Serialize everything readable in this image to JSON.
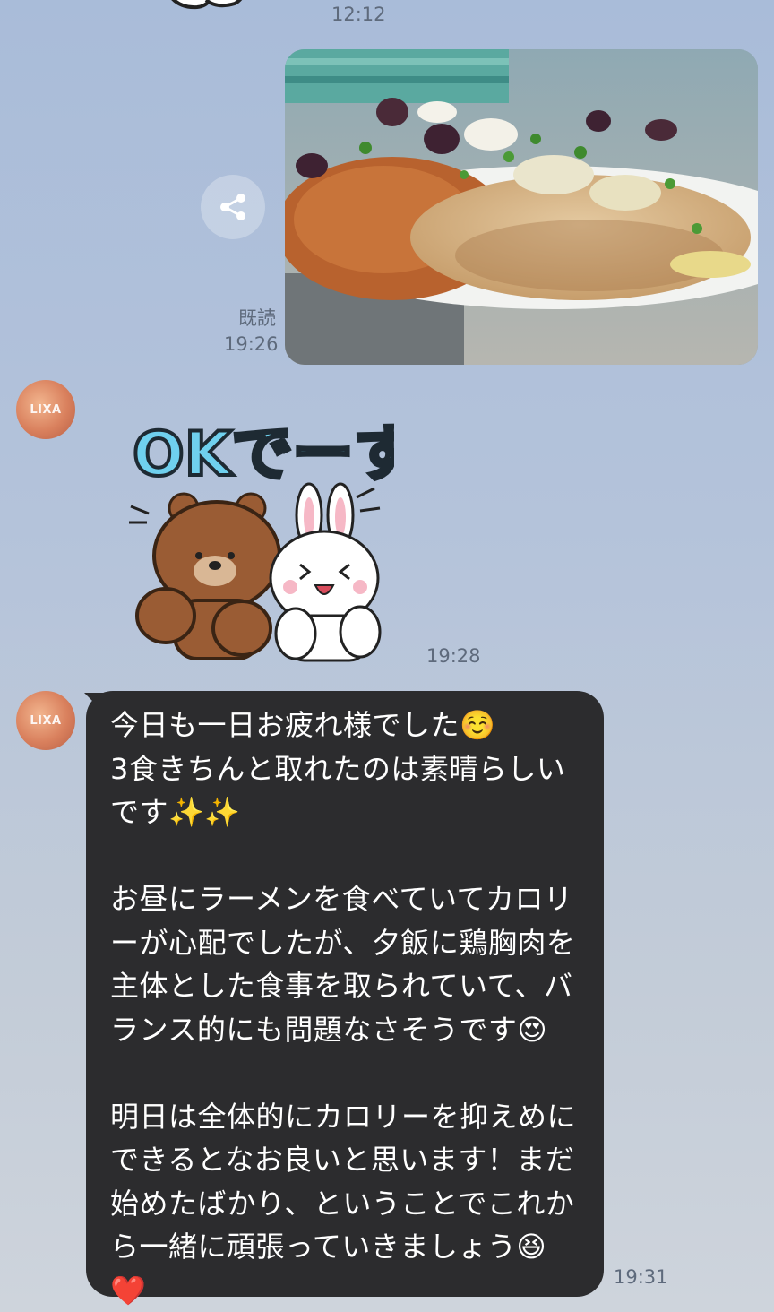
{
  "messages": [
    {
      "id": "m1",
      "sender": "user",
      "type": "sticker",
      "time": "12:12"
    },
    {
      "id": "m2",
      "sender": "user",
      "type": "photo",
      "read_label": "既読",
      "time": "19:26",
      "icon": "share-icon"
    },
    {
      "id": "m3",
      "sender": "LIXA",
      "avatar_label": "LIXA",
      "type": "sticker",
      "sticker_text": "OKでーす!",
      "time": "19:28"
    },
    {
      "id": "m4",
      "sender": "LIXA",
      "avatar_label": "LIXA",
      "type": "text",
      "text": "今日も一日お疲れ様でした☺️\n3食きちんと取れたのは素晴らしい\nです✨✨\n\nお昼にラーメンを食べていてカロリ\nーが心配でしたが、夕飯に鶏胸肉を\n主体とした食事を取られていて、バ\nランス的にも問題なさそうです😍\n\n明日は全体的にカロリーを抑えめに\nできるとなお良いと思います！まだ\n始めたばかり、ということでこれか\nら一緒に頑張っていきましょう😆\n❤️",
      "time": "19:31"
    }
  ],
  "colors": {
    "background_top": "#a9bcd9",
    "bubble": "#2c2c2e",
    "bubble_text": "#ffffff",
    "meta_text": "#5e6a7c"
  }
}
